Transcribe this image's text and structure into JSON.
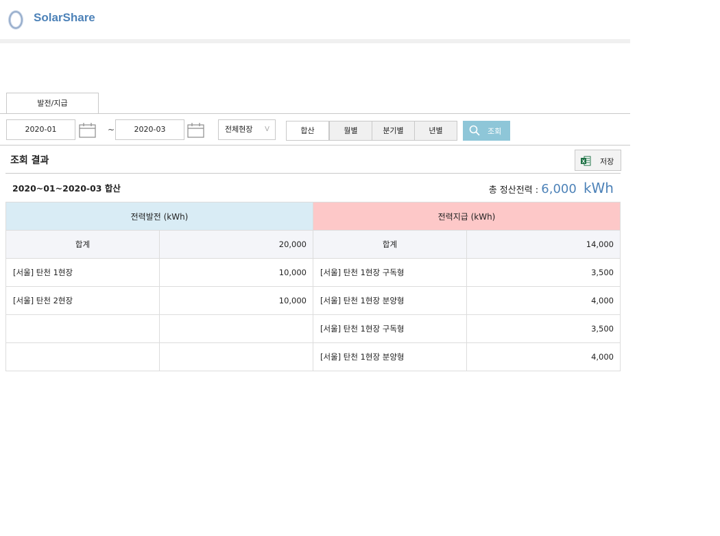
{
  "app": {
    "name": "SolarShare"
  },
  "tabs": [
    {
      "label": "발전/지급"
    }
  ],
  "filters": {
    "date_from": "2020-01",
    "date_to": "2020-03",
    "range_sep": "~",
    "site_select": "전체현장",
    "site_select_chevron": "V",
    "period_buttons": [
      "합산",
      "월별",
      "분기별",
      "년별"
    ],
    "search_label": "조회"
  },
  "results": {
    "title": "조회 결과",
    "save_label": "저장",
    "period_label": "2020~01~2020-03 합산",
    "total_label": "총 정산전력 :",
    "total_value": "6,000",
    "total_unit": "kWh"
  },
  "table": {
    "generation_header": "전력발전 (kWh)",
    "payment_header": "전력지급 (kWh)",
    "sum_label": "합계",
    "generation_sum": "20,000",
    "payment_sum": "14,000",
    "rows": [
      {
        "gen_name": "[서울] 탄천 1현장",
        "gen_value": "10,000",
        "pay_name": "[서울] 탄천 1현장 구독형",
        "pay_value": "3,500"
      },
      {
        "gen_name": "[서울] 탄천 2현장",
        "gen_value": "10,000",
        "pay_name": "[서울] 탄천 1현장 분양형",
        "pay_value": "4,000"
      },
      {
        "gen_name": "",
        "gen_value": "",
        "pay_name": "[서울] 탄천 1현장 구독형",
        "pay_value": "3,500"
      },
      {
        "gen_name": "",
        "gen_value": "",
        "pay_name": "[서울] 탄천 1현장 분양형",
        "pay_value": "4,000"
      }
    ]
  },
  "colors": {
    "brand": "#4d82b8",
    "search_button": "#8ec6d8",
    "generation_header_bg": "#d9ecf5",
    "payment_header_bg": "#fdc8c8"
  },
  "icons": {
    "logo": "ring-logo-icon",
    "calendar": "calendar-icon",
    "search": "magnifier-icon",
    "save": "excel-icon"
  }
}
